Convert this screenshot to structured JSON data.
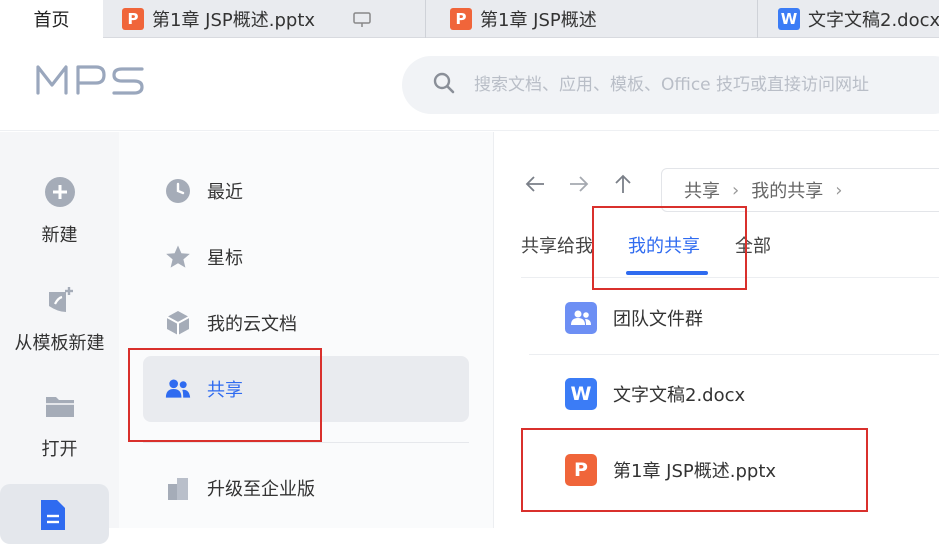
{
  "tabs": {
    "home": "首页",
    "t1": "第1章 JSP概述.pptx",
    "t2": "第1章 JSP概述",
    "t3": "文字文稿2.docx"
  },
  "header": {
    "logo": "WPS",
    "search_placeholder": "搜索文档、应用、模板、Office 技巧或直接访问网址"
  },
  "rail": {
    "new": "新建",
    "from_template": "从模板新建",
    "open": "打开"
  },
  "nav": {
    "recent": "最近",
    "starred": "星标",
    "cloud": "我的云文档",
    "share": "共享",
    "upgrade": "升级至企业版"
  },
  "main": {
    "breadcrumb": [
      "共享",
      "我的共享"
    ],
    "subtabs": [
      "共享给我",
      "我的共享",
      "全部"
    ],
    "files": [
      {
        "name": "团队文件群",
        "type": "team"
      },
      {
        "name": "文字文稿2.docx",
        "type": "word"
      },
      {
        "name": "第1章 JSP概述.pptx",
        "type": "ppt"
      }
    ]
  },
  "colors": {
    "accent": "#2f6bf0",
    "ppt": "#f0653a",
    "word": "#3b7cf6",
    "highlight": "#d9302c"
  }
}
